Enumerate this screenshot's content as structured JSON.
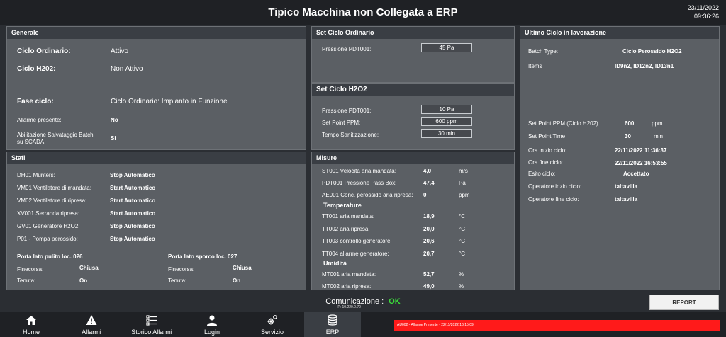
{
  "header": {
    "title": "Tipico Macchina non Collegata a ERP",
    "date": "23/11/2022",
    "time": "09:36:26"
  },
  "generale": {
    "title": "Generale",
    "ciclo_ordinario_label": "Ciclo Ordinario:",
    "ciclo_ordinario_value": "Attivo",
    "ciclo_h202_label": "Ciclo H202:",
    "ciclo_h202_value": "Non Attivo",
    "fase_label": "Fase ciclo:",
    "fase_value": "Ciclo Ordinario: Impianto in Funzione",
    "allarme_label": "Allarme presente:",
    "allarme_value": "No",
    "salv_label_1": "Abilitazione Salvataggio Batch",
    "salv_label_2": "su SCADA",
    "salv_value": "Si"
  },
  "stati": {
    "title": "Stati",
    "rows": [
      {
        "label": "DH01 Munters:",
        "value": "Stop Automatico"
      },
      {
        "label": "VM01 Ventilatore di mandata:",
        "value": "Start Automatico"
      },
      {
        "label": "VM02 Ventilatore di ripresa:",
        "value": "Start Automatico"
      },
      {
        "label": "XV001 Serranda ripresa:",
        "value": "Start Automatico"
      },
      {
        "label": "GV01 Generatore H2O2:",
        "value": "Stop Automatico"
      },
      {
        "label": "P01 - Pompa perossido:",
        "value": "Stop Automatico"
      }
    ],
    "porta_pulito": {
      "title": "Porta lato pulito loc. 026",
      "finecorsa_label": "Finecorsa:",
      "finecorsa_value": "Chiusa",
      "tenuta_label": "Tenuta:",
      "tenuta_value": "On"
    },
    "porta_sporco": {
      "title": "Porta lato sporco loc. 027",
      "finecorsa_label": "Finecorsa:",
      "finecorsa_value": "Chiusa",
      "tenuta_label": "Tenuta:",
      "tenuta_value": "On"
    }
  },
  "set_ordinario": {
    "title": "Set Ciclo Ordinario",
    "pressione_label": "Pressione PDT001:",
    "pressione_value": "45 Pa"
  },
  "set_h2o2": {
    "title": "Set Ciclo H2O2",
    "pressione_label": "Pressione PDT001:",
    "pressione_value": "10 Pa",
    "ppm_label": "Set Point PPM:",
    "ppm_value": "600 ppm",
    "tempo_label": "Tempo Sanitizzazione:",
    "tempo_value": "30 min"
  },
  "misure": {
    "title": "Misure",
    "rows": [
      {
        "label": "ST001 Velocità aria mandata:",
        "value": "4,0",
        "unit": "m/s"
      },
      {
        "label": "PDT001 Pressione Pass Box:",
        "value": "47,4",
        "unit": "Pa"
      },
      {
        "label": "AE001 Conc. perossido aria ripresa:",
        "value": "0",
        "unit": "ppm"
      }
    ],
    "temperature_title": "Temperature",
    "temperature": [
      {
        "label": "TT001 aria mandata:",
        "value": "18,9",
        "unit": "°C"
      },
      {
        "label": "TT002 aria ripresa:",
        "value": "20,0",
        "unit": "°C"
      },
      {
        "label": "TT003  controllo generatore:",
        "value": "20,6",
        "unit": "°C"
      },
      {
        "label": "TT004  allarme generatore:",
        "value": "20,7",
        "unit": "°C"
      }
    ],
    "umidita_title": "Umidità",
    "umidita": [
      {
        "label": "MT001 aria mandata:",
        "value": "52,7",
        "unit": "%"
      },
      {
        "label": "MT002 aria ripresa:",
        "value": "49,0",
        "unit": "%"
      }
    ]
  },
  "ultimo": {
    "title": "Ultimo Ciclo in lavorazione",
    "batch_label": "Batch Type:",
    "batch_value": "Ciclo Perossido H2O2",
    "items_label": "Items",
    "items_value": "ID9n2, ID12n2, ID13n1",
    "sp_ppm_label": "Set Point PPM (Ciclo H202)",
    "sp_ppm_value": "600",
    "sp_ppm_unit": "ppm",
    "sp_time_label": "Set Point Time",
    "sp_time_value": "30",
    "sp_time_unit": "min",
    "inizio_label": "Ora inizio ciclo:",
    "inizio_value": "22/11/2022 11:36:37",
    "fine_label": "Ora fine ciclo:",
    "fine_value": "22/11/2022 16:53:55",
    "esito_label": "Esito ciclo:",
    "esito_value": "Accettato",
    "op_inizio_label": "Operatore inzio ciclo:",
    "op_inizio_value": "taltavilla",
    "op_fine_label": "Operatore fine ciclo:",
    "op_fine_value": "taltavilla"
  },
  "status": {
    "comunicazione_label": "Comunicazione :",
    "comunicazione_value": "OK",
    "ip": "IP: 10.220.0.70"
  },
  "report_label": "REPORT",
  "nav": [
    {
      "label": "Home",
      "icon": "home-icon"
    },
    {
      "label": "Allarmi",
      "icon": "warning-icon"
    },
    {
      "label": "Storico Allarmi",
      "icon": "list-icon"
    },
    {
      "label": "Login",
      "icon": "user-icon"
    },
    {
      "label": "Servizio",
      "icon": "gears-icon"
    },
    {
      "label": "ERP",
      "icon": "database-icon"
    }
  ],
  "alarm_text": "AU002 - Allarme Presente - 22/11/2022 16:15:09",
  "colors": {
    "ok": "#3adb3a",
    "alarm": "#ff1a1a",
    "panel": "#5b5f64",
    "header": "#3a3e44"
  }
}
